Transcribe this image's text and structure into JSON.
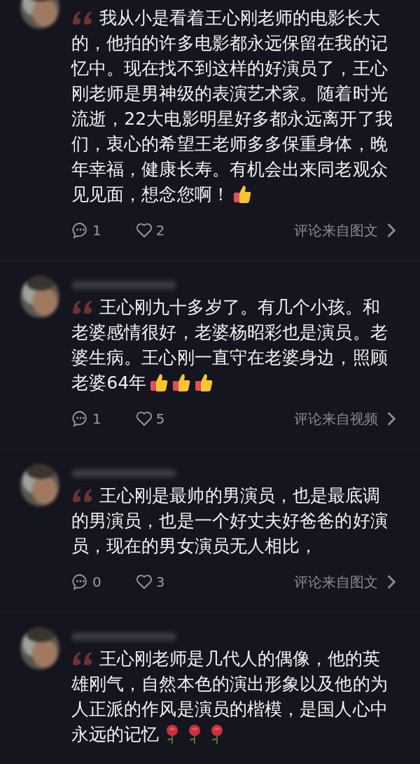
{
  "comments": [
    {
      "text": "我从小是看着王心刚老师的电影长大的，他拍的许多电影都永远保留在我的记忆中。现在找不到这样的好演员了，王心刚老师是男神级的表演艺术家。随着时光流逝，22大电影明星好多都永远离开了我们，衷心的希望王老师多多保重身体，晚年幸福，健康长寿。有机会出来同老观众见见面，想念您啊！",
      "emojis": [
        {
          "kind": "thumbs_up"
        }
      ],
      "replies": "1",
      "likes": "2",
      "source": "评论来自图文"
    },
    {
      "blurred_name": true,
      "text": "王心刚九十多岁了。有几个小孩。和老婆感情很好，老婆杨昭彩也是演员。老婆生病。王心刚一直守在老婆身边，照顾老婆64年",
      "emojis": [
        {
          "kind": "thumbs_up"
        },
        {
          "kind": "thumbs_up"
        },
        {
          "kind": "thumbs_up"
        }
      ],
      "replies": "1",
      "likes": "5",
      "source": "评论来自视频"
    },
    {
      "blurred_name": true,
      "text": "王心刚是最帅的男演员，也是最底调的男演员，也是一个好丈夫好爸爸的好演员，现在的男女演员无人相比，",
      "replies": "0",
      "likes": "3",
      "source": "评论来自图文"
    },
    {
      "blurred_name": true,
      "text": "王心刚老师是几代人的偶像，他的英雄刚气，自然本色的演出形象以及他的为人正派的作风是演员的楷模，是国人心中永远的记忆",
      "emojis": [
        {
          "kind": "rose"
        },
        {
          "kind": "rose"
        },
        {
          "kind": "rose"
        }
      ]
    }
  ]
}
